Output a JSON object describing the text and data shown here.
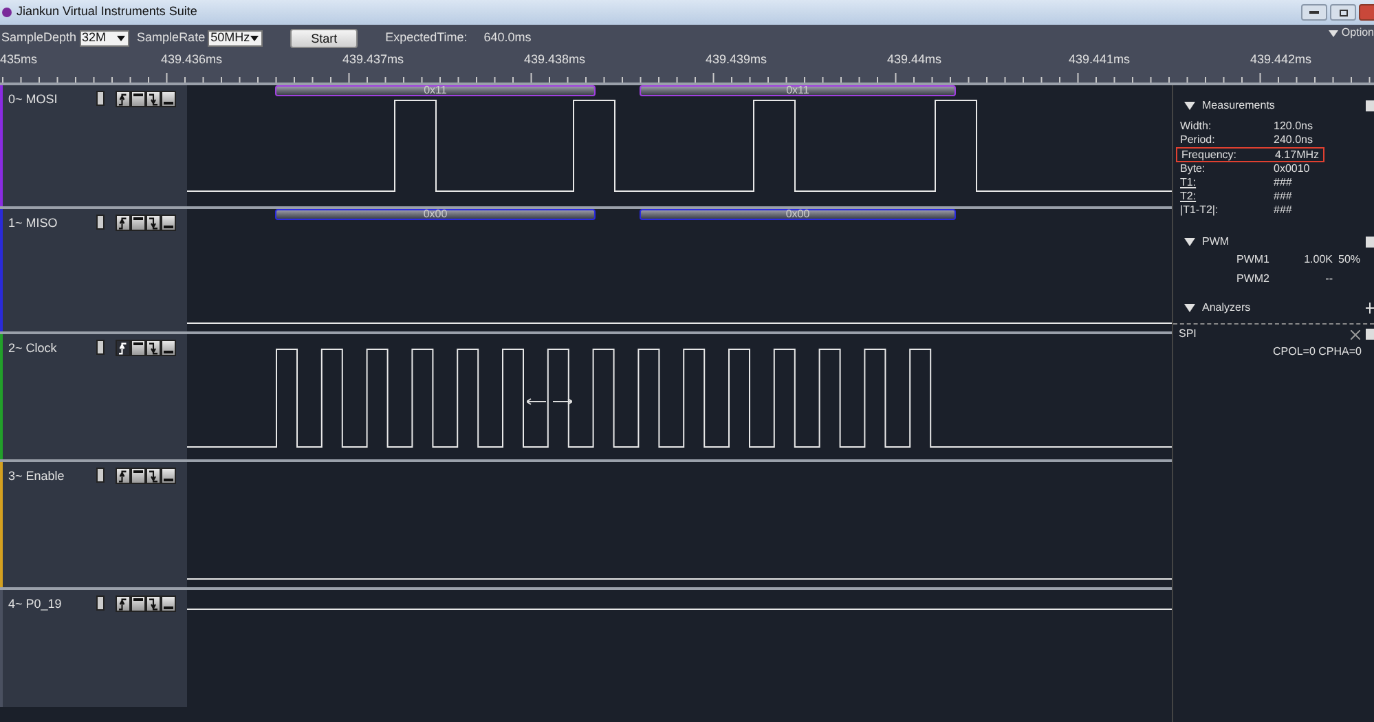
{
  "window": {
    "title": "Jiankun Virtual Instruments Suite"
  },
  "toolbar": {
    "sample_depth": {
      "label": "SampleDepth",
      "value": "32M"
    },
    "sample_rate": {
      "label": "SampleRate",
      "value": "50MHz"
    },
    "start_button": "Start",
    "expected_time": {
      "label": "ExpectedTime:",
      "value": "640.0ms"
    },
    "options": "Option"
  },
  "ruler": {
    "labels": [
      "435ms",
      "439.436ms",
      "439.437ms",
      "439.438ms",
      "439.439ms",
      "439.44ms",
      "439.441ms",
      "439.442ms"
    ]
  },
  "channels": [
    {
      "name": "0~ MOSI",
      "color": "#8a2be2",
      "kind": "pulses",
      "decoded": [
        "0x11",
        "0x11"
      ],
      "triggers": [
        {
          "kind": "rising",
          "selected": false
        },
        {
          "kind": "high",
          "selected": false
        },
        {
          "kind": "falling",
          "selected": false
        },
        {
          "kind": "low",
          "selected": false
        }
      ]
    },
    {
      "name": "1~ MISO",
      "color": "#2a2ad8",
      "kind": "low",
      "decoded": [
        "0x00",
        "0x00"
      ],
      "triggers": [
        {
          "kind": "rising",
          "selected": false
        },
        {
          "kind": "high",
          "selected": false
        },
        {
          "kind": "falling",
          "selected": false
        },
        {
          "kind": "low",
          "selected": false
        }
      ]
    },
    {
      "name": "2~ Clock",
      "color": "#22a02a",
      "kind": "clock",
      "triggers": [
        {
          "kind": "rising",
          "selected": true
        },
        {
          "kind": "high",
          "selected": false
        },
        {
          "kind": "falling",
          "selected": false
        },
        {
          "kind": "low",
          "selected": false
        }
      ]
    },
    {
      "name": "3~ Enable",
      "color": "#d4a020",
      "kind": "low",
      "triggers": [
        {
          "kind": "rising",
          "selected": false
        },
        {
          "kind": "high",
          "selected": false
        },
        {
          "kind": "falling",
          "selected": false
        },
        {
          "kind": "low",
          "selected": false
        }
      ]
    },
    {
      "name": "4~ P0_19",
      "color": "#4a5060",
      "kind": "top",
      "triggers": [
        {
          "kind": "rising",
          "selected": false
        },
        {
          "kind": "high",
          "selected": false
        },
        {
          "kind": "falling",
          "selected": false
        },
        {
          "kind": "low",
          "selected": false
        }
      ]
    }
  ],
  "measurements": {
    "title": "Measurements",
    "expanded": true,
    "rows": [
      {
        "label": "Width:",
        "value": "120.0ns",
        "underlined": false,
        "highlighted": false
      },
      {
        "label": "Period:",
        "value": "240.0ns",
        "underlined": false,
        "highlighted": false
      },
      {
        "label": "Frequency:",
        "value": "4.17MHz",
        "underlined": false,
        "highlighted": true
      },
      {
        "label": "Byte:",
        "value": "0x0010",
        "underlined": false,
        "highlighted": false
      },
      {
        "label": "T1:",
        "value": "###",
        "underlined": true,
        "highlighted": false
      },
      {
        "label": "T2:",
        "value": "###",
        "underlined": true,
        "highlighted": false
      },
      {
        "label": "|T1-T2|:",
        "value": "###",
        "underlined": false,
        "highlighted": false
      }
    ]
  },
  "pwm": {
    "title": "PWM",
    "expanded": true,
    "rows": [
      {
        "name": "PWM1",
        "value": "1.00K",
        "duty": "50%"
      },
      {
        "name": "PWM2",
        "value": "--",
        "duty": ""
      }
    ]
  },
  "analyzers": {
    "title": "Analyzers",
    "expanded": true,
    "items": [
      {
        "name": "SPI",
        "settings": "CPOL=0 CPHA=0"
      }
    ]
  }
}
